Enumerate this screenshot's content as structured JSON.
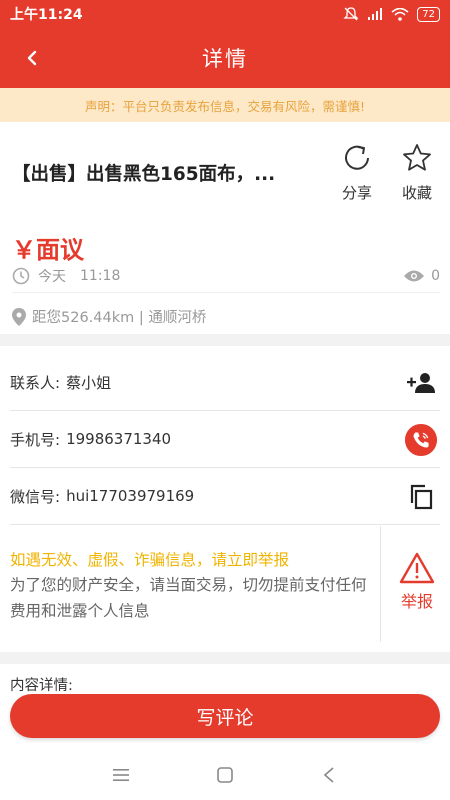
{
  "status_bar": {
    "time": "上午11:24",
    "battery": "72"
  },
  "nav": {
    "title": "详情"
  },
  "notice": {
    "text": "声明：平台只负责发布信息，交易有风险，需谨慎!"
  },
  "post": {
    "title": "【出售】出售黑色165面布，...",
    "share_label": "分享",
    "favorite_label": "收藏",
    "price": "￥面议",
    "date": "今天",
    "time": "11:18",
    "views": "0",
    "location": "距您526.44km | 通顺河桥"
  },
  "contact": {
    "person_label": "联系人:",
    "person_value": "蔡小姐",
    "phone_label": "手机号:",
    "phone_value": "19986371340",
    "wechat_label": "微信号:",
    "wechat_value": "hui17703979169"
  },
  "warning": {
    "title": "如遇无效、虚假、诈骗信息，请立即举报",
    "text": "为了您的财产安全，请当面交易，切勿提前支付任何费用和泄露个人信息",
    "report_label": "举报"
  },
  "content": {
    "label": "内容详情:"
  },
  "comment_button": "写评论",
  "colors": {
    "primary": "#e53b2d",
    "warning": "#f0b400",
    "notice_bg": "#fde8c8"
  }
}
